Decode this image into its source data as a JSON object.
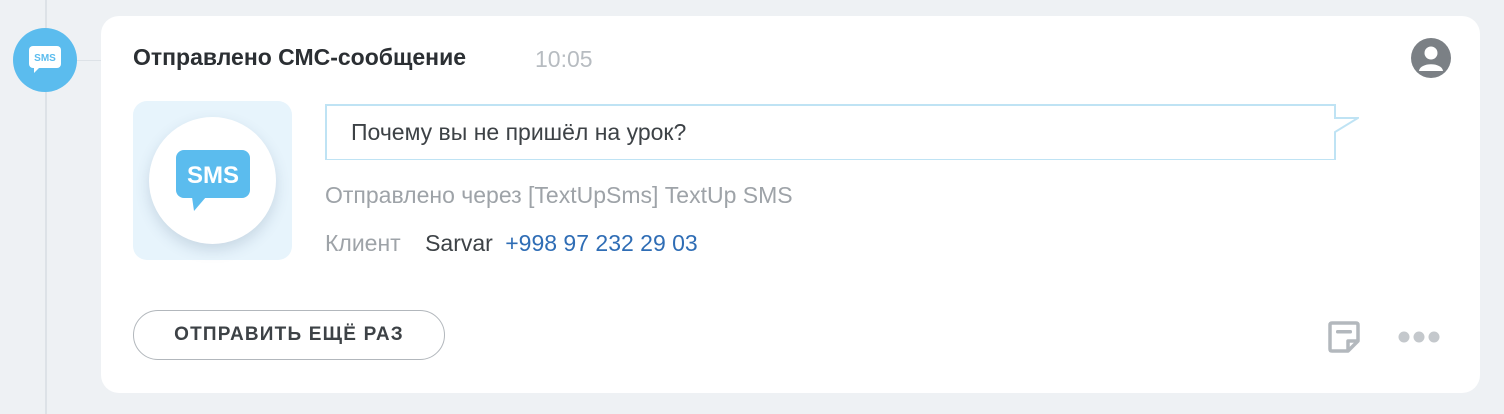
{
  "event": {
    "title": "Отправлено СМС-сообщение",
    "time": "10:05",
    "badge_text": "SMS"
  },
  "message": {
    "text": "Почему вы не пришёл на урок?",
    "sent_via": "Отправлено через [TextUpSms] TextUp SMS"
  },
  "client": {
    "label": "Клиент",
    "name": "Sarvar",
    "phone": "+998 97 232 29 03"
  },
  "actions": {
    "resend_label": "ОТПРАВИТЬ ЕЩЁ РАЗ"
  },
  "icons": {
    "timeline": "sms-bubble-icon",
    "avatar": "user-avatar-icon",
    "note": "note-icon",
    "more": "more-dots-icon"
  },
  "colors": {
    "accent": "#5bbcee",
    "link": "#2f6db5",
    "background": "#eef1f4"
  }
}
